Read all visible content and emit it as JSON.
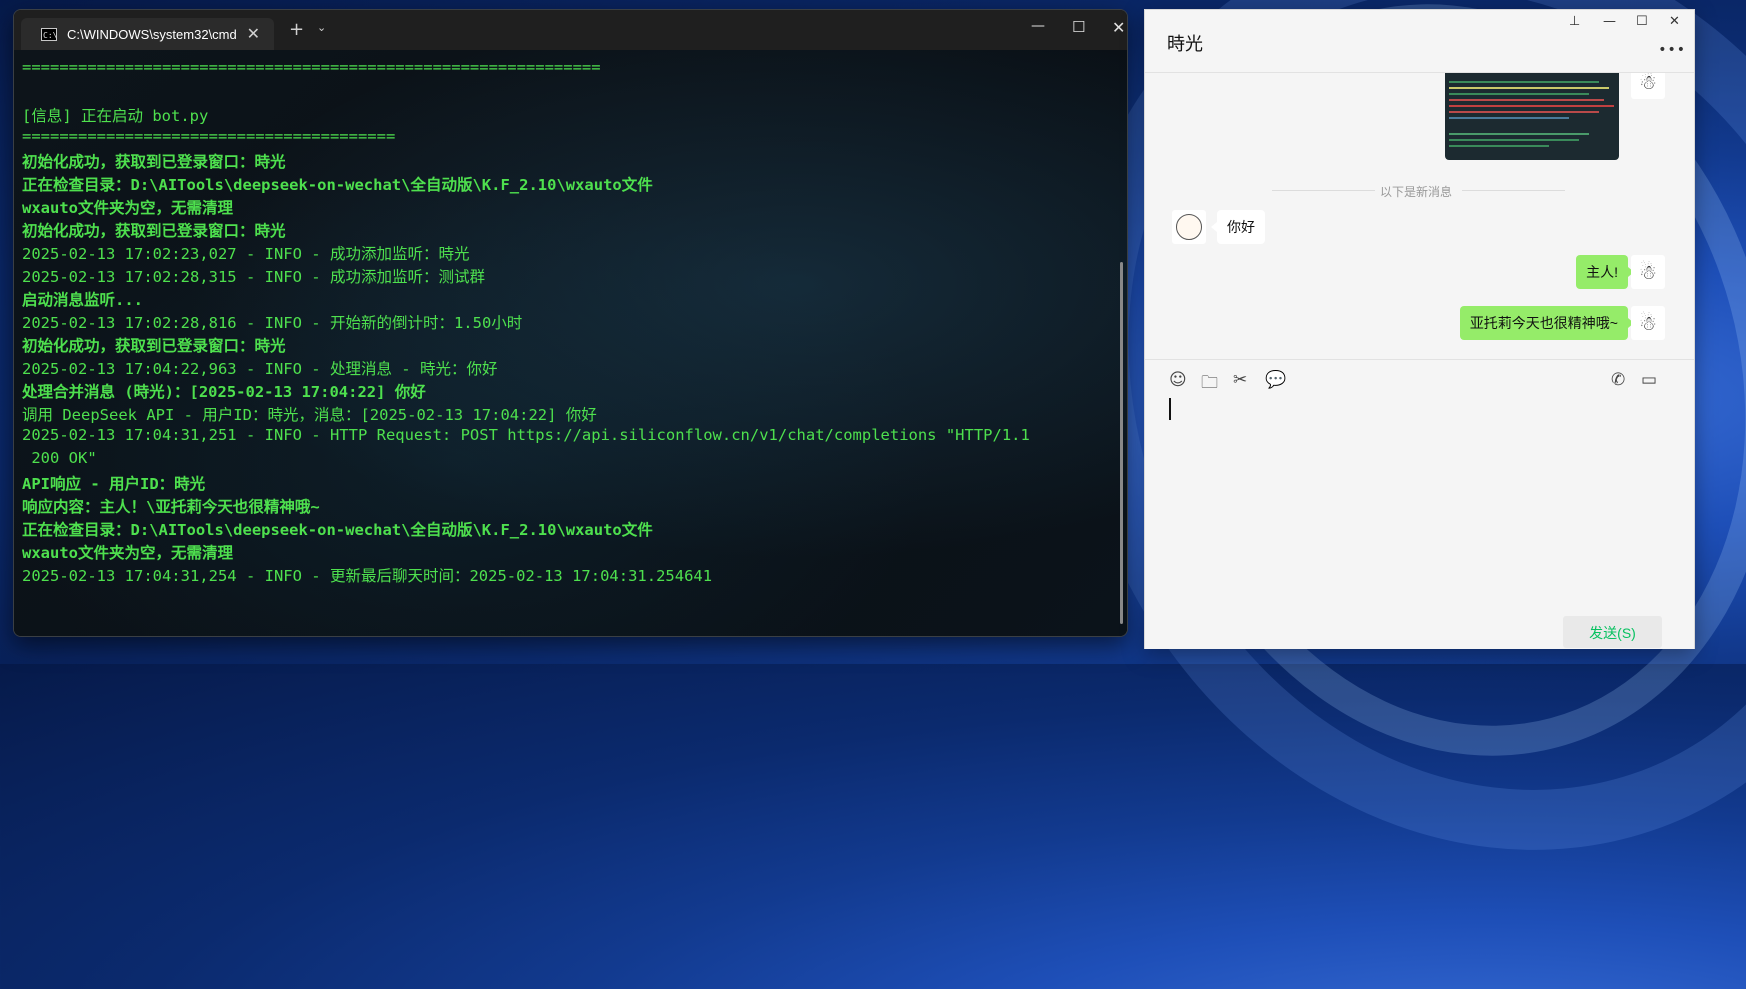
{
  "terminal": {
    "tab_title": "C:\\WINDOWS\\system32\\cmd.",
    "tab_icon_text": "C:\\",
    "lines": [
      {
        "text": "==============================================================",
        "bold": false
      },
      {
        "text": "",
        "bold": false
      },
      {
        "text": "[信息] 正在启动 bot.py",
        "bold": false
      },
      {
        "text": "========================================",
        "bold": false
      },
      {
        "text": "初始化成功，获取到已登录窗口：時光",
        "bold": true
      },
      {
        "text": "正在检查目录：D:\\AITools\\deepseek-on-wechat\\全自动版\\K.F_2.10\\wxauto文件",
        "bold": true
      },
      {
        "text": "wxauto文件夹为空，无需清理",
        "bold": true
      },
      {
        "text": "初始化成功，获取到已登录窗口：時光",
        "bold": true
      },
      {
        "text": "2025-02-13 17:02:23,027 - INFO - 成功添加监听：時光",
        "bold": false
      },
      {
        "text": "2025-02-13 17:02:28,315 - INFO - 成功添加监听：测试群",
        "bold": false
      },
      {
        "text": "启动消息监听...",
        "bold": true
      },
      {
        "text": "2025-02-13 17:02:28,816 - INFO - 开始新的倒计时：1.50小时",
        "bold": false
      },
      {
        "text": "初始化成功，获取到已登录窗口：時光",
        "bold": true
      },
      {
        "text": "2025-02-13 17:04:22,963 - INFO - 处理消息 - 時光：你好",
        "bold": false
      },
      {
        "text": "处理合并消息 (時光)：[2025-02-13 17:04:22] 你好",
        "bold": true
      },
      {
        "text": "调用 DeepSeek API - 用户ID：時光，消息：[2025-02-13 17:04:22] 你好",
        "bold": false
      },
      {
        "text": "2025-02-13 17:04:31,251 - INFO - HTTP Request: POST https://api.siliconflow.cn/v1/chat/completions \"HTTP/1.1",
        "bold": false
      },
      {
        "text": " 200 OK\"",
        "bold": false
      },
      {
        "text": "API响应 - 用户ID：時光",
        "bold": true
      },
      {
        "text": "响应内容：主人！\\亚托莉今天也很精神哦~",
        "bold": true
      },
      {
        "text": "正在检查目录：D:\\AITools\\deepseek-on-wechat\\全自动版\\K.F_2.10\\wxauto文件",
        "bold": true
      },
      {
        "text": "wxauto文件夹为空，无需清理",
        "bold": true
      },
      {
        "text": "2025-02-13 17:04:31,254 - INFO - 更新最后聊天时间：2025-02-13 17:04:31.254641",
        "bold": false
      }
    ],
    "text_color": "#4ee04e"
  },
  "wechat": {
    "contact_name": "時光",
    "divider_text": "以下是新消息",
    "messages": [
      {
        "from": "contact",
        "text": "你好"
      },
      {
        "from": "me",
        "text": "主人!"
      },
      {
        "from": "me",
        "text": "亚托莉今天也很精神哦~"
      }
    ],
    "send_label": "发送(S)",
    "send_color": "#07c160",
    "bubble_out_color": "#95ec69"
  }
}
